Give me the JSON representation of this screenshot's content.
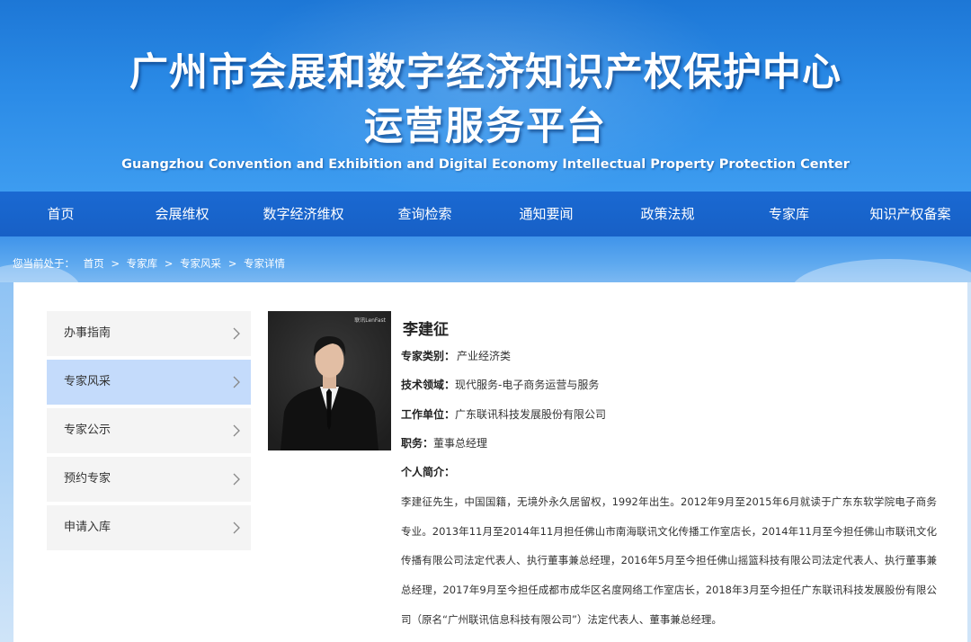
{
  "header": {
    "title_line1": "广州市会展和数字经济知识产权保护中心",
    "title_line2": "运营服务平台",
    "subtitle": "Guangzhou Convention and Exhibition and Digital Economy Intellectual Property Protection Center"
  },
  "nav": {
    "items": [
      "首页",
      "会展维权",
      "数字经济维权",
      "查询检索",
      "通知要闻",
      "政策法规",
      "专家库",
      "知识产权备案"
    ]
  },
  "breadcrumb": {
    "prefix": "您当前处于：",
    "items": [
      "首页",
      "专家库",
      "专家风采",
      "专家详情"
    ],
    "separator": ">"
  },
  "sidebar": {
    "items": [
      {
        "label": "办事指南",
        "active": false
      },
      {
        "label": "专家风采",
        "active": true
      },
      {
        "label": "专家公示",
        "active": false
      },
      {
        "label": "预约专家",
        "active": false
      },
      {
        "label": "申请入库",
        "active": false
      }
    ]
  },
  "expert": {
    "photo_logo_text": "联讯LenFast",
    "name": "李建征",
    "category_label": "专家类别：",
    "category_value": "产业经济类",
    "field_label": "技术领域：",
    "field_value": "现代服务-电子商务运营与服务",
    "unit_label": "工作单位：",
    "unit_value": "广东联讯科技发展股份有限公司",
    "position_label": "职务：",
    "position_value": "董事总经理",
    "bio_heading": "个人简介：",
    "bio": "李建征先生，中国国籍，无境外永久居留权，1992年出生。2012年9月至2015年6月就读于广东东软学院电子商务专业。2013年11月至2014年11月担任佛山市南海联讯文化传播工作室店长，2014年11月至今担任佛山市联讯文化传播有限公司法定代表人、执行董事兼总经理，2016年5月至今担任佛山摇篮科技有限公司法定代表人、执行董事兼总经理，2017年9月至今担任成都市成华区名度网络工作室店长，2018年3月至今担任广东联讯科技发展股份有限公司（原名“广州联讯信息科技有限公司”）法定代表人、董事兼总经理。"
  },
  "colors": {
    "banner": "#2a8ae6",
    "nav": "#1a69d2",
    "sidebar_active": "#c4dbfb",
    "sidebar_item": "#f4f4f4"
  }
}
